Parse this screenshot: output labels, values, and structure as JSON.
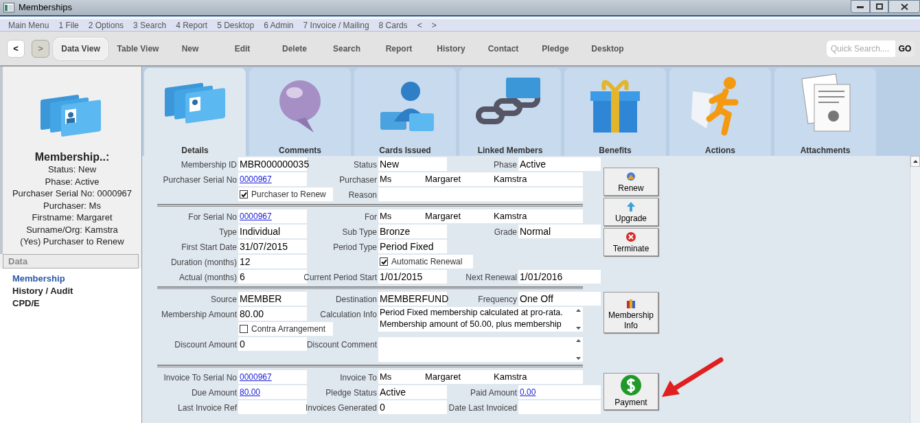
{
  "window": {
    "title": "Memberships"
  },
  "menu": [
    "Main Menu",
    "1 File",
    "2 Options",
    "3 Search",
    "4 Report",
    "5 Desktop",
    "6 Admin",
    "7 Invoice / Mailing",
    "8 Cards",
    "<",
    ">"
  ],
  "nav": [
    {
      "label": "<",
      "disabled": false
    },
    {
      "label": ">",
      "disabled": true
    }
  ],
  "toolbar": [
    {
      "label": "Data View",
      "selected": true
    },
    {
      "label": "Table View",
      "selected": false
    },
    {
      "label": "New",
      "selected": false
    },
    {
      "label": "Edit",
      "selected": false
    },
    {
      "label": "Delete",
      "selected": false
    },
    {
      "label": "Search",
      "selected": false
    },
    {
      "label": "Report",
      "selected": false
    },
    {
      "label": "History",
      "selected": false
    },
    {
      "label": "Contact",
      "selected": false
    },
    {
      "label": "Pledge",
      "selected": false
    },
    {
      "label": "Desktop",
      "selected": false
    }
  ],
  "quick_search": {
    "placeholder": "Quick Search....",
    "button": "GO"
  },
  "sidebar": {
    "title": "Membership..:",
    "lines": [
      "Status: New",
      "Phase: Active",
      "Purchaser Serial No: 0000967",
      "Purchaser: Ms",
      "Firstname: Margaret",
      "Surname/Org: Kamstra",
      "(Yes) Purchaser to Renew"
    ],
    "section": "Data",
    "items": [
      {
        "label": "Membership",
        "selected": true
      },
      {
        "label": "History / Audit",
        "selected": false
      },
      {
        "label": "CPD/E",
        "selected": false
      }
    ]
  },
  "tabs": [
    {
      "label": "Details",
      "kind": "cards",
      "selected": true
    },
    {
      "label": "Comments",
      "kind": "bubble",
      "selected": false
    },
    {
      "label": "Cards Issued",
      "kind": "person",
      "selected": false
    },
    {
      "label": "Linked Members",
      "kind": "chain",
      "selected": false
    },
    {
      "label": "Benefits",
      "kind": "gift",
      "selected": false
    },
    {
      "label": "Actions",
      "kind": "runner",
      "selected": false
    },
    {
      "label": "Attachments",
      "kind": "documents",
      "selected": false
    }
  ],
  "sections": [
    {
      "rows": [
        [
          {
            "label": "Membership ID",
            "value": "MBR000000035",
            "kind": "text"
          },
          {
            "label": "Status",
            "value": "New",
            "kind": "text"
          },
          {
            "label": "Phase",
            "value": "Active",
            "kind": "text"
          }
        ],
        [
          {
            "label": "Purchaser Serial No",
            "value": "0000967",
            "kind": "link"
          },
          {
            "label": "Purchaser",
            "kind": "person",
            "parts": [
              "Ms",
              "Margaret",
              "Kamstra"
            ]
          }
        ],
        [
          {
            "kind": "checkbox",
            "value": "Purchaser to Renew",
            "checked": true
          },
          {
            "label": "Reason",
            "kind": "person"
          }
        ]
      ]
    },
    {
      "rows": [
        [
          {
            "label": "For Serial No",
            "value": "0000967",
            "kind": "link"
          },
          {
            "label": "For",
            "kind": "person",
            "parts": [
              "Ms",
              "Margaret",
              "Kamstra"
            ]
          }
        ],
        [
          {
            "label": "Type",
            "value": "Individual",
            "kind": "text"
          },
          {
            "label": "Sub Type",
            "value": "Bronze",
            "kind": "text"
          },
          {
            "label": "Grade",
            "value": "Normal",
            "kind": "text"
          }
        ],
        [
          {
            "label": "First Start Date",
            "value": "31/07/2015",
            "kind": "text"
          },
          {
            "label": "Period Type",
            "value": "Period Fixed",
            "kind": "text"
          }
        ],
        [
          {
            "label": "Duration (months)",
            "value": "12",
            "kind": "text"
          },
          {
            "kind": "checkbox",
            "value": "Automatic Renewal",
            "checked": true
          }
        ],
        [
          {
            "label": "Actual (months)",
            "value": "6",
            "kind": "text"
          },
          {
            "label": "Current Period Start",
            "value": "1/01/2015",
            "kind": "text"
          },
          {
            "label": "Next Renewal",
            "value": "1/01/2016",
            "kind": "text"
          }
        ]
      ]
    },
    {
      "rows": [
        [
          {
            "label": "Source",
            "value": "MEMBER",
            "kind": "text"
          },
          {
            "label": "Destination",
            "value": "MEMBERFUND",
            "kind": "text"
          },
          {
            "label": "Frequency",
            "value": "One Off",
            "kind": "text"
          }
        ],
        [
          {
            "label": "Membership Amount",
            "value": "80.00",
            "kind": "text"
          },
          {
            "label": "Calculation Info",
            "value": "Period Fixed membership calculated at pro-rata. Membership amount of 50.00, plus membership",
            "kind": "memo"
          }
        ],
        [
          {
            "kind": "checkbox",
            "value": "Contra Arrangement",
            "checked": false
          }
        ],
        [
          {
            "label": "Discount Amount",
            "value": "0",
            "kind": "text"
          },
          {
            "label": "Discount Comment",
            "kind": "memo"
          }
        ]
      ]
    },
    {
      "rows": [
        [
          {
            "label": "Invoice To Serial No",
            "value": "0000967",
            "kind": "link"
          },
          {
            "label": "Invoice To",
            "kind": "person",
            "parts": [
              "Ms",
              "Margaret",
              "Kamstra"
            ]
          }
        ],
        [
          {
            "label": "Due Amount",
            "value": "80.00",
            "kind": "link"
          },
          {
            "label": "Pledge Status",
            "value": "Active",
            "kind": "text"
          },
          {
            "label": "Paid Amount",
            "value": "0.00",
            "kind": "link"
          }
        ],
        [
          {
            "label": "Last Invoice Ref",
            "kind": "text"
          },
          {
            "label": "Invoices Generated",
            "value": "0",
            "kind": "text"
          },
          {
            "label": "Date Last Invoiced",
            "kind": "text"
          }
        ]
      ]
    }
  ],
  "actions": [
    {
      "label": "Renew",
      "kind": "renew"
    },
    {
      "label": "Upgrade",
      "kind": "upgrade"
    },
    {
      "label": "Terminate",
      "kind": "terminate"
    },
    {
      "label": "Membership Info",
      "kind": "info"
    },
    {
      "label": "Payment",
      "kind": "payment"
    }
  ]
}
